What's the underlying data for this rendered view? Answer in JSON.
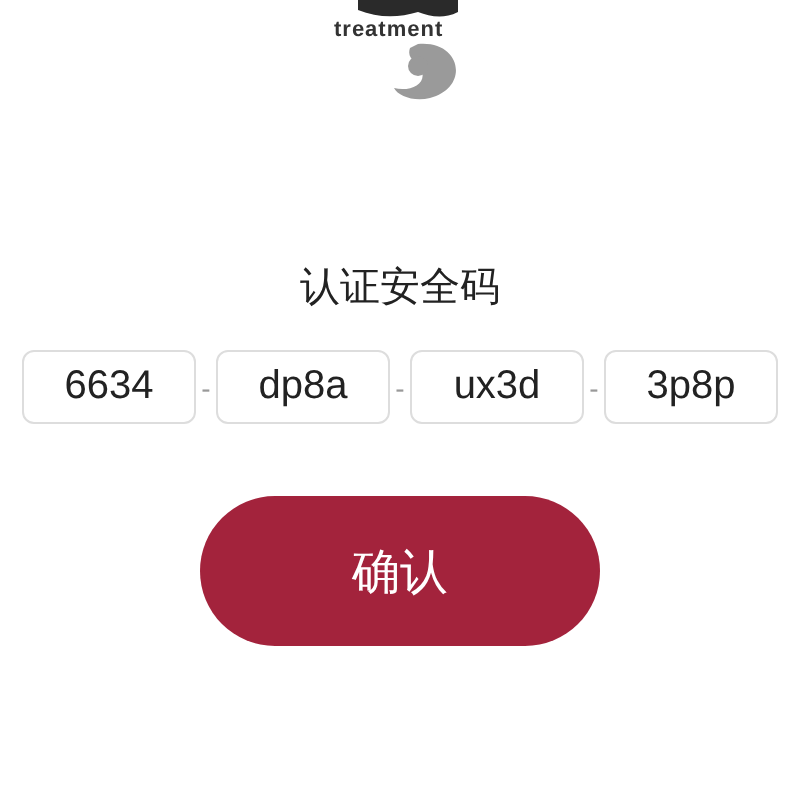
{
  "logo": {
    "tagline": "treatment"
  },
  "title": "认证安全码",
  "code_fields": [
    {
      "value": "6634"
    },
    {
      "value": "dp8a"
    },
    {
      "value": "ux3d"
    },
    {
      "value": "3p8p"
    }
  ],
  "separators": [
    "-",
    "-",
    "-"
  ],
  "confirm_button": {
    "label": "确认"
  }
}
